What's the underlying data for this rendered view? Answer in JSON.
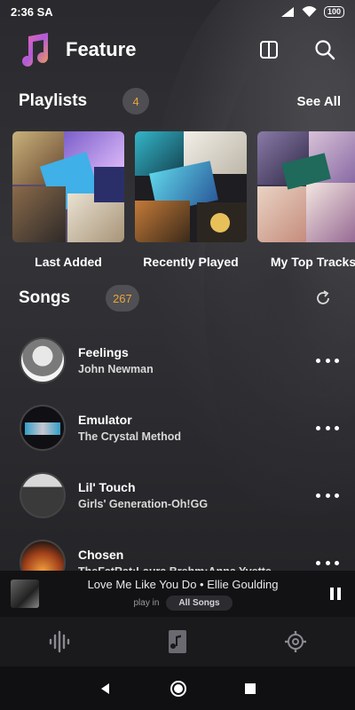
{
  "status_bar": {
    "time": "2:36 SA",
    "battery": "100"
  },
  "header": {
    "title": "Feature"
  },
  "playlists": {
    "heading": "Playlists",
    "count": "4",
    "see_all": "See All",
    "items": [
      {
        "name": "Last Added"
      },
      {
        "name": "Recently Played"
      },
      {
        "name": "My Top Tracks"
      }
    ]
  },
  "songs": {
    "heading": "Songs",
    "count": "267",
    "items": [
      {
        "title": "Feelings",
        "artist": "John Newman"
      },
      {
        "title": "Emulator",
        "artist": "The Crystal Method"
      },
      {
        "title": "Lil' Touch",
        "artist": "Girls' Generation-Oh!GG"
      },
      {
        "title": "Chosen",
        "artist": "TheFatRat:Laura Brehm:Anna Yvette"
      }
    ]
  },
  "mini_player": {
    "now_playing": "Love Me Like You Do • Ellie Goulding",
    "play_in_label": "play in",
    "source": "All Songs"
  },
  "colors": {
    "accent": "#e7a63a"
  }
}
